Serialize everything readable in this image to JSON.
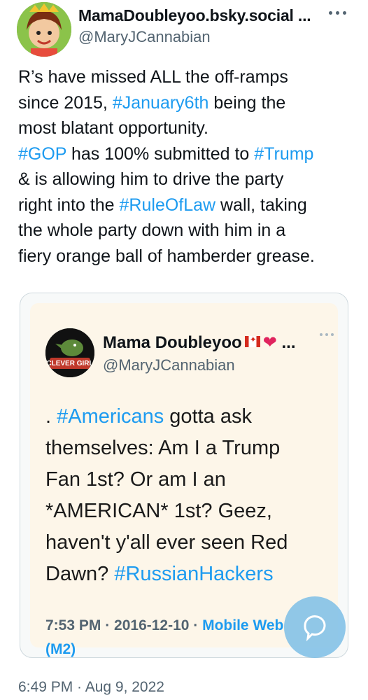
{
  "author": {
    "display_name": "MamaDoubleyoo.bsky.social ...",
    "handle": "@MaryJCannabian"
  },
  "tweet": {
    "lines": [
      [
        {
          "t": "R’s have missed ALL the off-ramps"
        }
      ],
      [
        {
          "t": "since 2015, "
        },
        {
          "t": "#January6th",
          "tag": true
        },
        {
          "t": " being the"
        }
      ],
      [
        {
          "t": "most blatant opportunity."
        }
      ],
      [
        {
          "t": "#GOP",
          "tag": true
        },
        {
          "t": " has 100% submitted to "
        },
        {
          "t": "#Trump",
          "tag": true
        }
      ],
      [
        {
          "t": "& is allowing him to drive the party"
        }
      ],
      [
        {
          "t": "right into the "
        },
        {
          "t": "#RuleOfLaw",
          "tag": true
        },
        {
          "t": " wall, taking"
        }
      ],
      [
        {
          "t": "the whole party down with him in a"
        }
      ],
      [
        {
          "t": "fiery orange ball of hamberder grease."
        }
      ]
    ]
  },
  "quote": {
    "avatar_label": "CLEVER GIRL",
    "display_name": "Mama Doubleyoo",
    "display_suffix": "...",
    "handle": "@MaryJCannabian",
    "lines": [
      [
        {
          "t": ". "
        },
        {
          "t": "#Americans",
          "tag": true
        },
        {
          "t": " gotta ask"
        }
      ],
      [
        {
          "t": "themselves: Am I a Trump"
        }
      ],
      [
        {
          "t": "Fan 1st? Or am I an"
        }
      ],
      [
        {
          "t": "*AMERICAN* 1st? Geez,"
        }
      ],
      [
        {
          "t": "haven't y'all ever seen Red"
        }
      ],
      [
        {
          "t": "Dawn? "
        },
        {
          "t": "#RussianHackers",
          "tag": true
        }
      ]
    ],
    "meta_time": "7:53 PM · 2016-12-10 · ",
    "meta_source": "Mobile Web",
    "meta_source2": "(M2)"
  },
  "timestamp": "6:49 PM · Aug 9, 2022",
  "colors": {
    "link": "#1d9bf0",
    "secondary": "#536471",
    "quote_bg": "#fdf6e9"
  }
}
